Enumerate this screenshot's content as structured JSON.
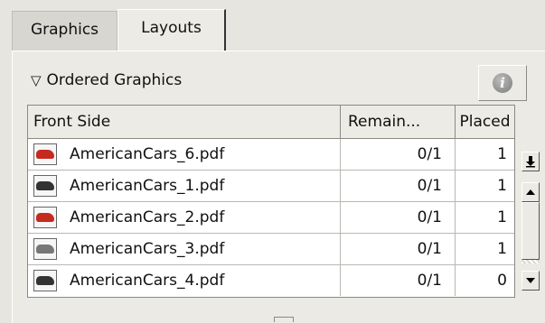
{
  "tabs": [
    {
      "label": "Graphics",
      "active": false
    },
    {
      "label": "Layouts",
      "active": true
    }
  ],
  "section": {
    "title": "Ordered Graphics",
    "expanded": true,
    "info_icon": "info-icon"
  },
  "table": {
    "columns": [
      "Front Side",
      "Remain...",
      "Placed"
    ],
    "rows": [
      {
        "name": "AmericanCars_6.pdf",
        "remain": "0/1",
        "placed": "1",
        "thumb": "red-car"
      },
      {
        "name": "AmericanCars_1.pdf",
        "remain": "0/1",
        "placed": "1",
        "thumb": "dark-car"
      },
      {
        "name": "AmericanCars_2.pdf",
        "remain": "0/1",
        "placed": "1",
        "thumb": "red-car"
      },
      {
        "name": "AmericanCars_3.pdf",
        "remain": "0/1",
        "placed": "1",
        "thumb": "gray-car"
      },
      {
        "name": "AmericanCars_4.pdf",
        "remain": "0/1",
        "placed": "0",
        "thumb": "dark-car"
      }
    ]
  },
  "icons": {
    "download": "download-arrow-icon",
    "scroll_up": "scroll-up-arrow-icon",
    "scroll_down": "scroll-down-arrow-icon"
  }
}
